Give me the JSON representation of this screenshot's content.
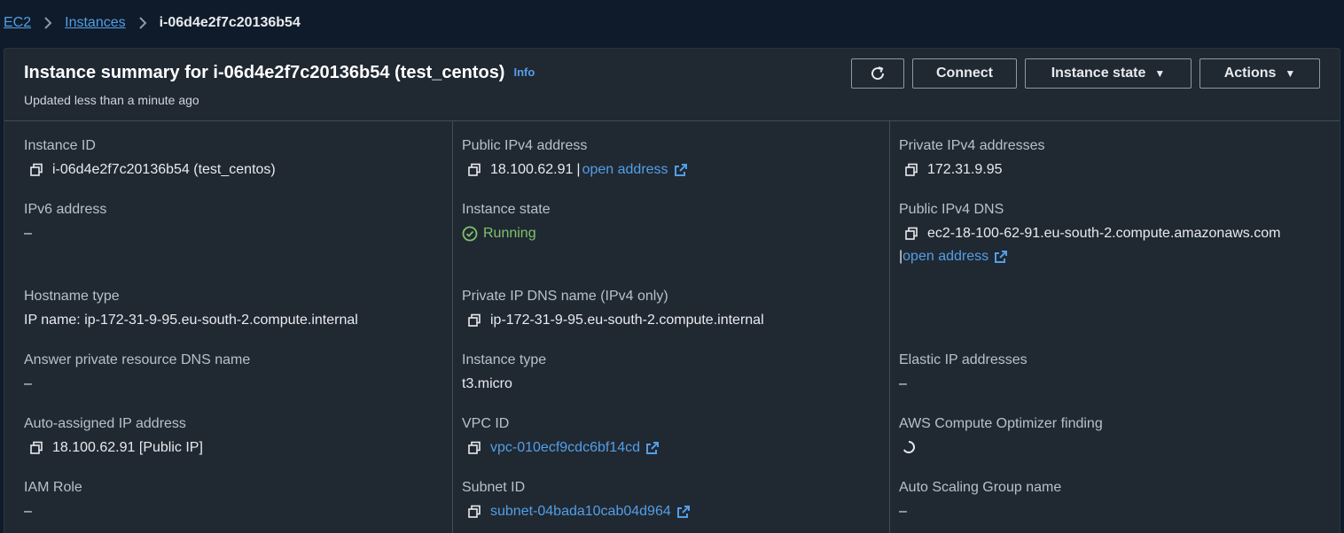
{
  "breadcrumb": {
    "ec2": "EC2",
    "instances": "Instances",
    "current": "i-06d4e2f7c20136b54"
  },
  "header": {
    "title": "Instance summary for i-06d4e2f7c20136b54 (test_centos)",
    "info": "Info",
    "updated": "Updated less than a minute ago",
    "connect": "Connect",
    "instance_state": "Instance state",
    "actions": "Actions"
  },
  "col1": {
    "instance_id_label": "Instance ID",
    "instance_id_value": "i-06d4e2f7c20136b54 (test_centos)",
    "ipv6_label": "IPv6 address",
    "ipv6_value": "–",
    "hostname_type_label": "Hostname type",
    "hostname_type_value": "IP name: ip-172-31-9-95.eu-south-2.compute.internal",
    "answer_dns_label": "Answer private resource DNS name",
    "answer_dns_value": "–",
    "auto_ip_label": "Auto-assigned IP address",
    "auto_ip_value": "18.100.62.91 [Public IP]",
    "iam_role_label": "IAM Role",
    "iam_role_value": "–"
  },
  "col2": {
    "public_ipv4_label": "Public IPv4 address",
    "public_ipv4_value": "18.100.62.91",
    "open_address": "open address",
    "instance_state_label": "Instance state",
    "instance_state_value": "Running",
    "private_dns_label": "Private IP DNS name (IPv4 only)",
    "private_dns_value": "ip-172-31-9-95.eu-south-2.compute.internal",
    "instance_type_label": "Instance type",
    "instance_type_value": "t3.micro",
    "vpc_label": "VPC ID",
    "vpc_value": "vpc-010ecf9cdc6bf14cd",
    "subnet_label": "Subnet ID",
    "subnet_value": "subnet-04bada10cab04d964"
  },
  "col3": {
    "private_ipv4_label": "Private IPv4 addresses",
    "private_ipv4_value": "172.31.9.95",
    "public_dns_label": "Public IPv4 DNS",
    "public_dns_value": "ec2-18-100-62-91.eu-south-2.compute.amazonaws.com",
    "open_address": "open address",
    "elastic_ip_label": "Elastic IP addresses",
    "elastic_ip_value": "–",
    "optimizer_label": "AWS Compute Optimizer finding",
    "asg_label": "Auto Scaling Group name",
    "asg_value": "–"
  },
  "colors": {
    "link": "#539fe5",
    "success": "#7ec36b",
    "background": "#0f1b2a",
    "panel": "#202832"
  }
}
